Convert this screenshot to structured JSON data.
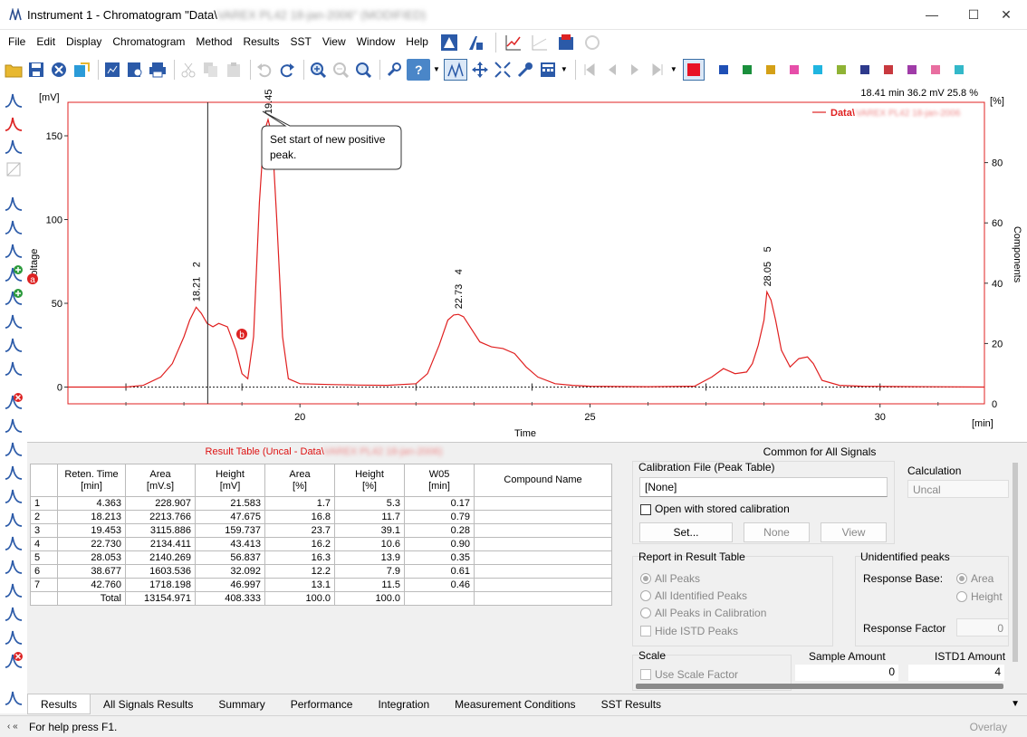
{
  "window": {
    "title": "Instrument 1 - Chromatogram \"Data\\",
    "title_blurred": "VAREX PL42 18-jan-2006\" (MODIFIED)"
  },
  "menu": [
    "File",
    "Edit",
    "Display",
    "Chromatogram",
    "Method",
    "Results",
    "SST",
    "View",
    "Window",
    "Help"
  ],
  "toolbar": {
    "colors": [
      "#e81123",
      "#1f4fb5",
      "#1a8f3c",
      "#d4a017",
      "#e64ea9",
      "#20b5e0",
      "#8fb335",
      "#2e3a8c",
      "#c8393f",
      "#a03ca8",
      "#e86ea0",
      "#33b8c9"
    ]
  },
  "chart": {
    "readout": "18.41 min   36.2 mV   25.8 %",
    "y_unit": "[mV]",
    "y_label": "Voltage",
    "y2_unit": "[%]",
    "y2_label": "Components",
    "x_label": "Time",
    "x_unit": "[min]",
    "legend": "Data\\",
    "legend_blurred": "VAREX PL42 18-jan-2006",
    "tooltip": [
      "Set start of new positive",
      "peak."
    ],
    "marker_a": "a",
    "marker_b": "b",
    "peak_labels": [
      {
        "id": "2",
        "time": "18.21"
      },
      {
        "id": "",
        "time": "19.45"
      },
      {
        "id": "4",
        "time": "22.73"
      },
      {
        "id": "5",
        "time": "28.05"
      }
    ]
  },
  "chart_data": {
    "type": "line",
    "xlabel": "Time",
    "ylabel": "Voltage",
    "xlim": [
      16.0,
      31.8
    ],
    "ylim": [
      -10,
      170
    ],
    "y2lim": [
      0,
      100
    ],
    "x_ticks": [
      20,
      25,
      30
    ],
    "y_ticks": [
      0,
      50,
      100,
      150
    ],
    "y2_ticks": [
      20,
      40,
      60,
      80
    ],
    "cursor_time": 18.41,
    "series": [
      {
        "name": "Data\\",
        "color": "#e02020",
        "x": [
          16.0,
          16.5,
          17.0,
          17.3,
          17.6,
          17.8,
          18.0,
          18.1,
          18.21,
          18.3,
          18.4,
          18.5,
          18.6,
          18.75,
          18.9,
          19.0,
          19.1,
          19.2,
          19.3,
          19.38,
          19.45,
          19.52,
          19.6,
          19.7,
          19.8,
          20.0,
          20.5,
          21.0,
          21.5,
          22.0,
          22.2,
          22.4,
          22.55,
          22.65,
          22.73,
          22.82,
          22.95,
          23.1,
          23.3,
          23.5,
          23.7,
          23.9,
          24.1,
          24.4,
          24.7,
          25.0,
          26.0,
          26.8,
          27.1,
          27.3,
          27.5,
          27.7,
          27.8,
          27.9,
          28.0,
          28.05,
          28.12,
          28.2,
          28.3,
          28.45,
          28.6,
          28.75,
          28.85,
          29.0,
          29.3,
          29.7,
          30.2,
          31.8
        ],
        "values": [
          0,
          0,
          0,
          1,
          6,
          14,
          30,
          40,
          47.7,
          44,
          38,
          36,
          38,
          36,
          22,
          8,
          5,
          30,
          110,
          152,
          159.7,
          150,
          100,
          30,
          5,
          2,
          1.5,
          1.2,
          1,
          2,
          8,
          25,
          40,
          43,
          43.4,
          42,
          35,
          27,
          24,
          23,
          20,
          12,
          6,
          2,
          1,
          0.5,
          0.2,
          0.5,
          6,
          11,
          8,
          9,
          14,
          25,
          40,
          56.8,
          52,
          40,
          22,
          12,
          17,
          18,
          14,
          4,
          1,
          0.5,
          0.3,
          0
        ]
      }
    ]
  },
  "results": {
    "title": "Result Table (Uncal - Data\\",
    "title_blurred": "VAREX PL42 18-jan-2006)",
    "headers": [
      "",
      "Reten. Time\n[min]",
      "Area\n[mV.s]",
      "Height\n[mV]",
      "Area\n[%]",
      "Height\n[%]",
      "W05\n[min]",
      "Compound Name"
    ],
    "rows": [
      [
        "1",
        "4.363",
        "228.907",
        "21.583",
        "1.7",
        "5.3",
        "0.17",
        ""
      ],
      [
        "2",
        "18.213",
        "2213.766",
        "47.675",
        "16.8",
        "11.7",
        "0.79",
        ""
      ],
      [
        "3",
        "19.453",
        "3115.886",
        "159.737",
        "23.7",
        "39.1",
        "0.28",
        ""
      ],
      [
        "4",
        "22.730",
        "2134.411",
        "43.413",
        "16.2",
        "10.6",
        "0.90",
        ""
      ],
      [
        "5",
        "28.053",
        "2140.269",
        "56.837",
        "16.3",
        "13.9",
        "0.35",
        ""
      ],
      [
        "6",
        "38.677",
        "1603.536",
        "32.092",
        "12.2",
        "7.9",
        "0.61",
        ""
      ],
      [
        "7",
        "42.760",
        "1718.198",
        "46.997",
        "13.1",
        "11.5",
        "0.46",
        ""
      ],
      [
        "",
        "Total",
        "13154.971",
        "408.333",
        "100.0",
        "100.0",
        "",
        ""
      ]
    ]
  },
  "panel": {
    "heading": "Common for All Signals",
    "calib_label": "Calibration File (Peak Table)",
    "calib_value": "[None]",
    "open_stored": "Open with stored calibration",
    "btn_set": "Set...",
    "btn_none": "None",
    "btn_view": "View",
    "calc_label": "Calculation",
    "calc_value": "Uncal",
    "report_label": "Report in Result Table",
    "report_opts": [
      "All Peaks",
      "All Identified Peaks",
      "All Peaks in Calibration"
    ],
    "hide_istd": "Hide ISTD Peaks",
    "unid_label": "Unidentified peaks",
    "resp_base": "Response Base:",
    "resp_area": "Area",
    "resp_height": "Height",
    "resp_factor": "Response Factor",
    "resp_factor_val": "0",
    "scale_label": "Scale",
    "use_scale": "Use Scale Factor",
    "sample_amount": "Sample Amount",
    "sample_amount_val": "0",
    "istd_amount": "ISTD1 Amount",
    "istd_amount_val": "4"
  },
  "tabs": [
    "Results",
    "All Signals Results",
    "Summary",
    "Performance",
    "Integration",
    "Measurement Conditions",
    "SST Results"
  ],
  "status": {
    "text": "For help press F1.",
    "overlay": "Overlay"
  }
}
